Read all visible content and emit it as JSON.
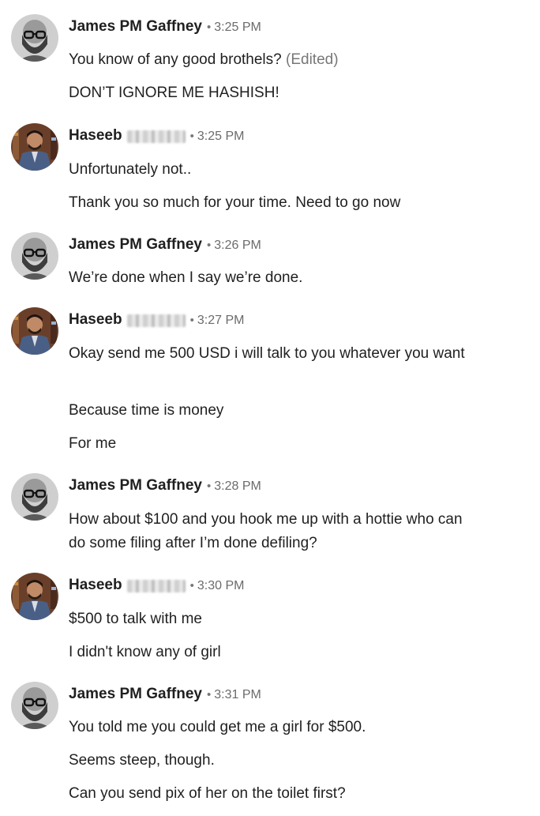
{
  "messages": [
    {
      "sender": "James PM Gaffney",
      "time": "3:25 PM",
      "avatar_icon": "bald-man-glasses-beard-avatar",
      "lines": [
        {
          "text": "You know of any good brothels?",
          "suffix": "(Edited)"
        },
        {
          "text": "DON’T IGNORE ME HASHISH!"
        }
      ]
    },
    {
      "sender": "Haseeb",
      "time": "3:25 PM",
      "avatar_icon": "man-in-suit-avatar",
      "lines": [
        {
          "text": "Unfortunately not.."
        },
        {
          "text": "Thank you so much for your time. Need to go now"
        }
      ]
    },
    {
      "sender": "James PM Gaffney",
      "time": "3:26 PM",
      "avatar_icon": "bald-man-glasses-beard-avatar",
      "lines": [
        {
          "text": "We’re done when I say we’re done."
        }
      ]
    },
    {
      "sender": "Haseeb",
      "time": "3:27 PM",
      "avatar_icon": "man-in-suit-avatar",
      "lines": [
        {
          "text": "Okay send me 500 USD i will talk to you whatever you want"
        },
        {
          "text": "Because time is money"
        },
        {
          "text": "For me"
        }
      ]
    },
    {
      "sender": "James PM Gaffney",
      "time": "3:28 PM",
      "avatar_icon": "bald-man-glasses-beard-avatar",
      "lines": [
        {
          "text": "How about $100 and you hook me up with a hottie who can do some filing after I’m done defiling?"
        }
      ]
    },
    {
      "sender": "Haseeb",
      "time": "3:30 PM",
      "avatar_icon": "man-in-suit-avatar",
      "lines": [
        {
          "text": "$500 to talk with me"
        },
        {
          "text": "I didn't know any of girl"
        }
      ]
    },
    {
      "sender": "James PM Gaffney",
      "time": "3:31 PM",
      "avatar_icon": "bald-man-glasses-beard-avatar",
      "lines": [
        {
          "text": "You told me you could get me a girl for $500."
        },
        {
          "text": "Seems steep, though."
        },
        {
          "text": "Can you send pix of her on the toilet first?"
        }
      ]
    }
  ],
  "separator": "•",
  "colors": {
    "text": "#1f1f1f",
    "meta": "#6b6b6b",
    "background": "#ffffff"
  }
}
